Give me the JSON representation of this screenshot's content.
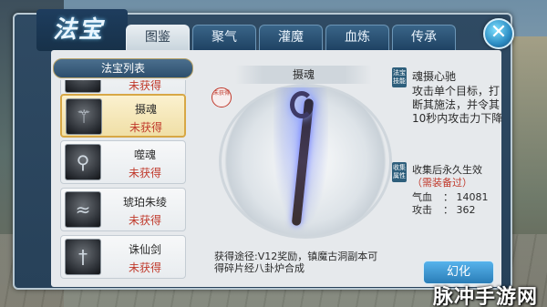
{
  "header": {
    "title": "法宝",
    "tabs": [
      {
        "label": "图鉴",
        "active": true
      },
      {
        "label": "聚气",
        "active": false
      },
      {
        "label": "灌魔",
        "active": false
      },
      {
        "label": "血炼",
        "active": false
      },
      {
        "label": "传承",
        "active": false
      }
    ],
    "close_icon": "close-icon"
  },
  "list": {
    "header": "法宝列表",
    "items": [
      {
        "name": "",
        "status": "未获得",
        "icon": "treasure-icon"
      },
      {
        "name": "摄魂",
        "status": "未获得",
        "icon": "staff-icon"
      },
      {
        "name": "噬魂",
        "status": "未获得",
        "icon": "staff-icon"
      },
      {
        "name": "琥珀朱绫",
        "status": "未获得",
        "icon": "silk-icon"
      },
      {
        "name": "诛仙剑",
        "status": "未获得",
        "icon": "sword-icon"
      }
    ]
  },
  "display": {
    "name": "摄魂",
    "seal": "未获得",
    "acquire_text": "获得途径:V12奖励，镇魔古洞副本可得碎片经八卦炉合成"
  },
  "info": {
    "skill_tag": "法宝技能",
    "skill_name": "魂摄心驰",
    "skill_desc": "攻击单个目标，打断其施法，并令其10秒内攻击力下降",
    "collect_tag": "收集属性",
    "collect_title": "收集后永久生效",
    "collect_note": "（需装备过）",
    "stats": [
      {
        "label": "气血",
        "value": "14081"
      },
      {
        "label": "攻击",
        "value": "362"
      }
    ]
  },
  "buttons": {
    "refine": "幻化"
  },
  "watermark": "脉冲手游网",
  "colors": {
    "accent": "#2a7db7",
    "warning": "#c0392b",
    "selected_border": "#d7a745"
  }
}
